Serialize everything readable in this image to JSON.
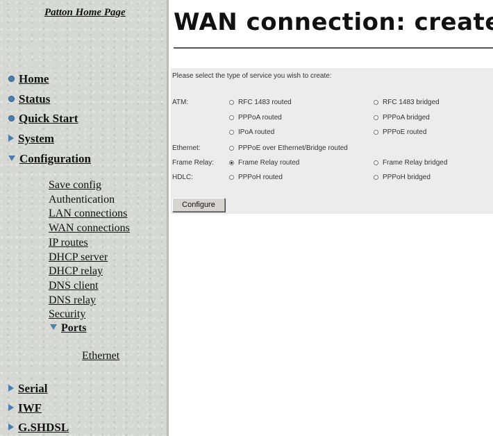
{
  "sidebar": {
    "home_page": "Patton Home Page",
    "nav": {
      "home": "Home",
      "status": "Status",
      "quick_start": "Quick Start",
      "system": "System",
      "configuration": "Configuration",
      "serial": "Serial",
      "iwf": "IWF",
      "gshdsl": "G.SHDSL"
    },
    "config_items": {
      "save_config": "Save config",
      "authentication": "Authentication",
      "lan_connections": "LAN connections",
      "wan_connections": "WAN connections",
      "ip_routes": "IP routes",
      "dhcp_server": "DHCP server",
      "dhcp_relay": "DHCP relay",
      "dns_client": "DNS client",
      "dns_relay": "DNS relay",
      "security": "Security",
      "ports": "Ports",
      "ethernet": "Ethernet"
    }
  },
  "main": {
    "title": "WAN connection: create",
    "instruction": "Please select the type of service you wish to create:",
    "groups": {
      "atm": "ATM:",
      "ethernet": "Ethernet:",
      "frame_relay": "Frame Relay:",
      "hdlc": "HDLC:"
    },
    "options": {
      "rfc1483_routed": "RFC 1483 routed",
      "rfc1483_bridged": "RFC 1483 bridged",
      "pppoa_routed": "PPPoA routed",
      "pppoa_bridged": "PPPoA bridged",
      "ipoa_routed": "IPoA routed",
      "pppoe_routed": "PPPoE routed",
      "pppoe_over_ethernet": "PPPoE over Ethernet/Bridge routed",
      "frame_relay_routed": "Frame Relay routed",
      "frame_relay_bridged": "Frame Relay bridged",
      "pppoh_routed": "PPPoH routed",
      "pppoh_bridged": "PPPoH bridged"
    },
    "selected_option": "frame_relay_routed",
    "configure_button": "Configure"
  },
  "colors": {
    "sidebar_bg": "#d6d8d3",
    "icon_accent": "#4a7fb0",
    "panel_bg": "#ececec"
  }
}
